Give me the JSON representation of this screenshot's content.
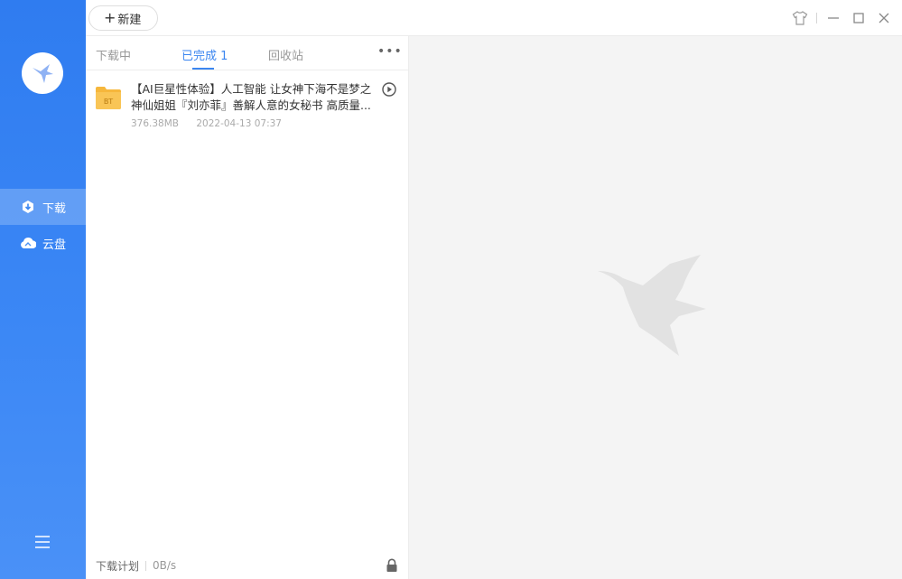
{
  "sidebar": {
    "nav": [
      {
        "label": "下载",
        "icon": "download-icon",
        "active": true
      },
      {
        "label": "云盘",
        "icon": "cloud-icon",
        "active": false
      }
    ]
  },
  "topbar": {
    "new_label": "新建"
  },
  "tabs": [
    {
      "label": "下载中",
      "active": false
    },
    {
      "label": "已完成 1",
      "active": true
    },
    {
      "label": "回收站",
      "active": false
    }
  ],
  "items": [
    {
      "title_line1": "【AI巨星性体验】人工智能 让女神下海不是梦之",
      "title_line2": "神仙姐姐『刘亦菲』善解人意的女秘书 高质量...",
      "size": "376.38MB",
      "date": "2022-04-13 07:37",
      "badge": "BT"
    }
  ],
  "footer": {
    "plan_label": "下载计划",
    "speed": "0B/s"
  },
  "colors": {
    "accent": "#3b86f0",
    "sidebar_top": "#2f7cf0",
    "folder": "#f6b73c"
  }
}
